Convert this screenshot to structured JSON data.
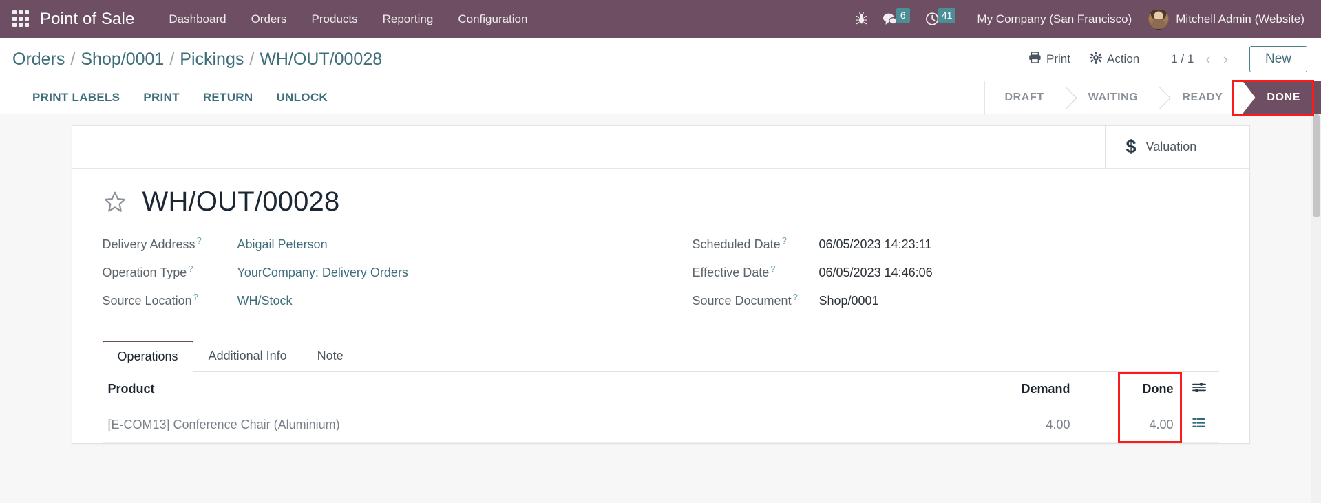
{
  "navbar": {
    "apps_icon": "apps-grid-icon",
    "brand": "Point of Sale",
    "menu": [
      {
        "label": "Dashboard"
      },
      {
        "label": "Orders"
      },
      {
        "label": "Products"
      },
      {
        "label": "Reporting"
      },
      {
        "label": "Configuration"
      }
    ],
    "systray": {
      "debug_icon": "bug-icon",
      "messages_icon": "messages-icon",
      "messages_count": "6",
      "activities_icon": "clock-icon",
      "activities_count": "41",
      "badge_color": "#4b8e96"
    },
    "company": "My Company (San Francisco)",
    "user": "Mitchell Admin (Website)",
    "bg_color": "#6d4e62"
  },
  "control_panel": {
    "breadcrumb": [
      {
        "label": "Orders",
        "current": false
      },
      {
        "label": "Shop/0001",
        "current": false
      },
      {
        "label": "Pickings",
        "current": false
      },
      {
        "label": "WH/OUT/00028",
        "current": true
      }
    ],
    "breadcrumb_separator": "/",
    "print_label": "Print",
    "print_icon": "printer-icon",
    "action_label": "Action",
    "action_icon": "gear-icon",
    "pager": "1 / 1",
    "prev_icon": "chevron-left-icon",
    "next_icon": "chevron-right-icon",
    "new_label": "New",
    "object_buttons": [
      {
        "label": "PRINT LABELS"
      },
      {
        "label": "PRINT"
      },
      {
        "label": "RETURN"
      },
      {
        "label": "UNLOCK"
      }
    ],
    "statusbar": [
      {
        "label": "DRAFT",
        "active": false
      },
      {
        "label": "WAITING",
        "active": false
      },
      {
        "label": "READY",
        "active": false
      },
      {
        "label": "DONE",
        "active": true
      }
    ],
    "highlight_color": "#fc1b1b"
  },
  "form": {
    "smart_buttons": [
      {
        "icon": "dollar-icon",
        "symbol": "$",
        "label": "Valuation"
      }
    ],
    "favorite_icon": "star-icon",
    "title": "WH/OUT/00028",
    "fields_left": [
      {
        "label": "Delivery Address",
        "value": "Abigail Peterson",
        "is_link": true
      },
      {
        "label": "Operation Type",
        "value": "YourCompany: Delivery Orders",
        "is_link": true
      },
      {
        "label": "Source Location",
        "value": "WH/Stock",
        "is_link": true
      }
    ],
    "fields_right": [
      {
        "label": "Scheduled Date",
        "value": "06/05/2023 14:23:11",
        "is_link": false
      },
      {
        "label": "Effective Date",
        "value": "06/05/2023 14:46:06",
        "is_link": false
      },
      {
        "label": "Source Document",
        "value": "Shop/0001",
        "is_link": false
      }
    ],
    "tooltip_marker": "?",
    "tabs": [
      {
        "label": "Operations",
        "active": true
      },
      {
        "label": "Additional Info",
        "active": false
      },
      {
        "label": "Note",
        "active": false
      }
    ],
    "table": {
      "columns": [
        {
          "label": "Product",
          "align": "left"
        },
        {
          "label": "Demand",
          "align": "right"
        },
        {
          "label": "Done",
          "align": "right"
        },
        {
          "label": "",
          "align": "center",
          "icon": "optional-columns-icon"
        }
      ],
      "rows": [
        {
          "product": "[E-COM13] Conference Chair (Aluminium)",
          "demand": "4.00",
          "done": "4.00",
          "detail_icon": "detailed-operations-icon"
        }
      ]
    }
  }
}
